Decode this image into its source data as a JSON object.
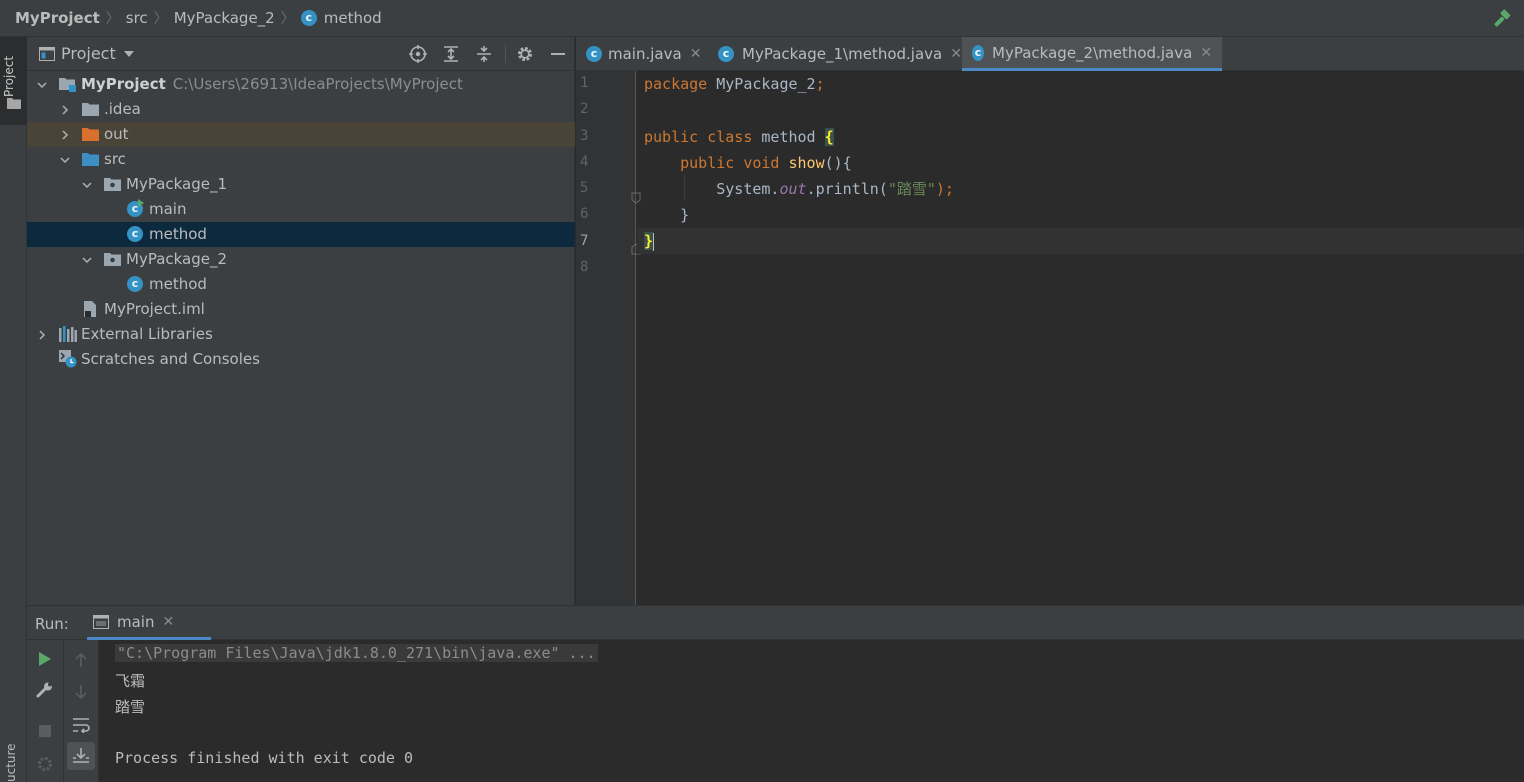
{
  "breadcrumb": {
    "items": [
      "MyProject",
      "src",
      "MyPackage_2",
      "method"
    ]
  },
  "left_strip": {
    "project_label": "Project",
    "structure_label": "ucture"
  },
  "project_panel": {
    "title": "Project",
    "tree": [
      {
        "label": "MyProject",
        "path": "C:\\Users\\26913\\IdeaProjects\\MyProject",
        "icon": "module-icon",
        "expanded": true
      },
      {
        "label": ".idea",
        "icon": "folder-icon",
        "expanded": false
      },
      {
        "label": "out",
        "icon": "folder-orange-icon",
        "expanded": false
      },
      {
        "label": "src",
        "icon": "source-folder-icon",
        "expanded": true
      },
      {
        "label": "MyPackage_1",
        "icon": "package-icon",
        "expanded": true
      },
      {
        "label": "main",
        "icon": "class-runnable-icon"
      },
      {
        "label": "method",
        "icon": "class-icon",
        "selected": true
      },
      {
        "label": "MyPackage_2",
        "icon": "package-icon",
        "expanded": true
      },
      {
        "label": "method",
        "icon": "class-icon"
      },
      {
        "label": "MyProject.iml",
        "icon": "iml-file-icon"
      },
      {
        "label": "External Libraries",
        "icon": "libraries-icon",
        "expanded": false
      },
      {
        "label": "Scratches and Consoles",
        "icon": "scratches-icon"
      }
    ]
  },
  "editor": {
    "tabs": [
      {
        "label": "main.java",
        "active": false
      },
      {
        "label": "MyPackage_1\\method.java",
        "active": false
      },
      {
        "label": "MyPackage_2\\method.java",
        "active": true
      }
    ],
    "line_numbers": [
      "1",
      "2",
      "3",
      "4",
      "5",
      "6",
      "7",
      "8"
    ],
    "current_line": "7",
    "code": {
      "l1_kw": "package",
      "l1_name": " MyPackage_2",
      "l1_semi": ";",
      "l3_kw": "public class",
      "l3_name": " method ",
      "l3_brace": "{",
      "l4_kw": "public void",
      "l4_fn": " show",
      "l4_rest": "(){",
      "l5_obj": "System.",
      "l5_field": "out",
      "l5_call": ".println(",
      "l5_str": "\"踏雪\"",
      "l5_end": ");",
      "l6_brace": "}",
      "l7_brace": "}"
    }
  },
  "run_panel": {
    "label": "Run:",
    "tab_label": "main",
    "console": {
      "command": "\"C:\\Program Files\\Java\\jdk1.8.0_271\\bin\\java.exe\" ...",
      "out1": "飞霜",
      "out2": "踏雪",
      "exit": "Process finished with exit code 0"
    }
  },
  "colors": {
    "panel_bg": "#3c3f41",
    "editor_bg": "#2b2b2b",
    "selection": "#0d293e",
    "accent": "#4a88c7",
    "keyword": "#cc7832",
    "function": "#ffc66d",
    "string": "#6a8759",
    "field": "#9876aa"
  }
}
